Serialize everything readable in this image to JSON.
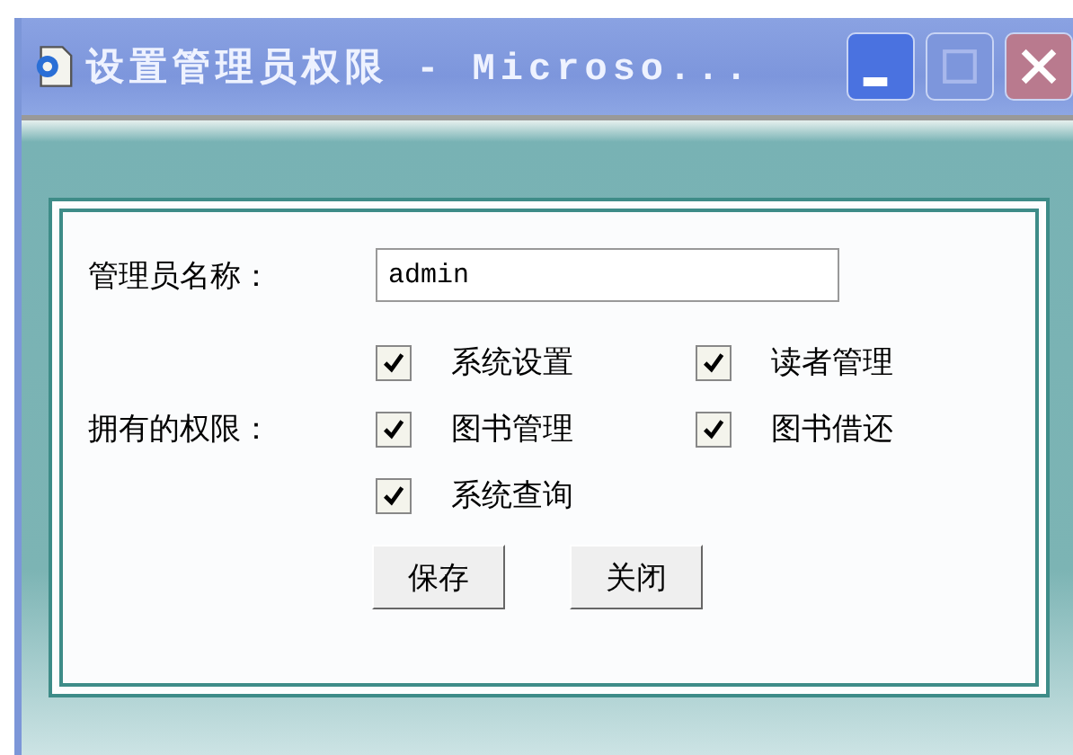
{
  "window": {
    "title": "设置管理员权限 - Microso..."
  },
  "form": {
    "name_label": "管理员名称：",
    "name_value": "admin",
    "permissions_label": "拥有的权限：",
    "permissions": [
      {
        "label": "系统设置",
        "checked": true
      },
      {
        "label": "读者管理",
        "checked": true
      },
      {
        "label": "图书管理",
        "checked": true
      },
      {
        "label": "图书借还",
        "checked": true
      },
      {
        "label": "系统查询",
        "checked": true
      }
    ],
    "buttons": [
      "保存",
      "关闭"
    ]
  }
}
